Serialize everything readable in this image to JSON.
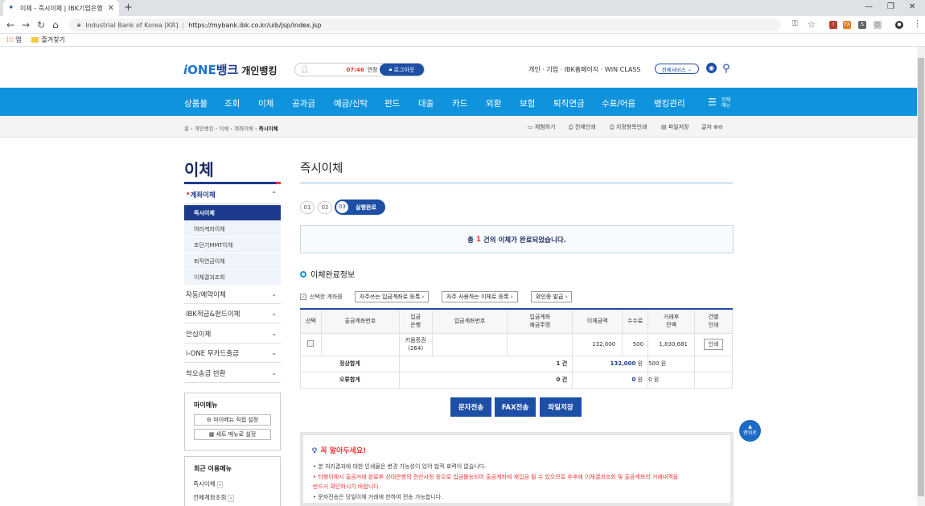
{
  "browser": {
    "tab_title": "이체 - 즉시이체 | IBK기업은행 ·",
    "site_name": "Industrial Bank of Korea [KR]",
    "url": "https://mybank.ibk.co.kr/uib/jsp/index.jsp",
    "bookmarks": [
      "앱",
      "즐겨찾기"
    ]
  },
  "header": {
    "logo_i": "i",
    "logo_one": "ONE",
    "logo_bank": "뱅크",
    "logo_sub": "개인뱅킹",
    "timer": "07:46",
    "extend": "연장",
    "logout": "로그아웃",
    "toplinks": "개인 · 기업 · IBK홈페이지 · WIN CLASS",
    "all_services": "전체서비스"
  },
  "gnb": {
    "items": [
      "상품몰",
      "조회",
      "이체",
      "공과금",
      "예금/신탁",
      "펀드",
      "대출",
      "카드",
      "외환",
      "보험",
      "퇴직연금",
      "수표/어음",
      "뱅킹관리"
    ],
    "all_menu": "전체\n메뉴"
  },
  "breadcrumb": {
    "path": "홈 › 개인뱅킹 › 이체 › 계좌이체 › ",
    "current": "즉시이체"
  },
  "utils": [
    "체험하기",
    "전체인쇄",
    "지정항목인쇄",
    "파일저장",
    "글자"
  ],
  "lnb": {
    "title": "이체",
    "group1": "계좌이체",
    "subs": [
      "즉시이체",
      "여러계좌이체",
      "초단기MMT이체",
      "퇴직연금이체",
      "이체결과조회"
    ],
    "groups": [
      "자동/예약이체",
      "IBK적금&펀드이체",
      "안심이체",
      "i-ONE 무카드출금",
      "착오송금 반환"
    ],
    "mymenu_title": "마이메뉴",
    "mymenu_btn1": "마이메뉴 직접 설정",
    "mymenu_btn2": "세트 메뉴로 설정",
    "recent_title": "최근 이용메뉴",
    "recent_items": [
      "즉시이체",
      "전체계좌조회"
    ]
  },
  "content": {
    "title": "즉시이체",
    "steps": [
      "01",
      "02",
      "03"
    ],
    "step3_label": "실행완료",
    "done_prefix": "총",
    "done_count": "1",
    "done_suffix": "건의 이체가 완료되었습니다.",
    "section_title": "이체완료정보",
    "selected_label": "선택한 계좌를",
    "btn_reg_in": "자주쓰는 입금계좌로 등록",
    "btn_reg_transfer": "자주 사용하는 이체로 등록",
    "btn_cert": "확인증 발급",
    "table_headers": [
      "선택",
      "출금계좌번호",
      "입금\n은행",
      "입금계좌번호",
      "입금계좌\n예금주명",
      "이체금액",
      "수수료",
      "거래후\n잔액",
      "건별\n인쇄"
    ],
    "row": {
      "bank": "키움증권\n(264)",
      "amount": "132,000",
      "fee": "500",
      "balance": "1,830,681",
      "print": "인쇄"
    },
    "sum_normal_label": "정상합계",
    "sum_normal_count": "1 건",
    "sum_normal_amount": "132,000",
    "sum_normal_amount_unit": "원",
    "sum_normal_fee": "500 원",
    "sum_error_label": "오류합계",
    "sum_error_count": "0 건",
    "sum_error_amount": "0",
    "sum_error_amount_unit": "원",
    "sum_error_fee": "0 원",
    "btn_sms": "문자전송",
    "btn_fax": "FAX전송",
    "btn_file": "파일저장",
    "top_btn": "맨위로"
  },
  "notice": {
    "title": "꼭 알아두세요!",
    "lines": [
      "• 본 처리결과에 대한 인쇄물은 변경 가능성이 있어 법적 효력이 없습니다.",
      "• 타행이체시 출금거래 완료후 상대은행의 전산사정 등으로 입금불능되어 출금계좌에 재입금 될 수 있으므로 추후에 이체결과조회 및 출금계좌의 거래내역을",
      "   반드시 확인하시기 바랍니다.",
      "• 문자전송은 당일이체 거래에 한하여 전송 가능합니다."
    ]
  }
}
